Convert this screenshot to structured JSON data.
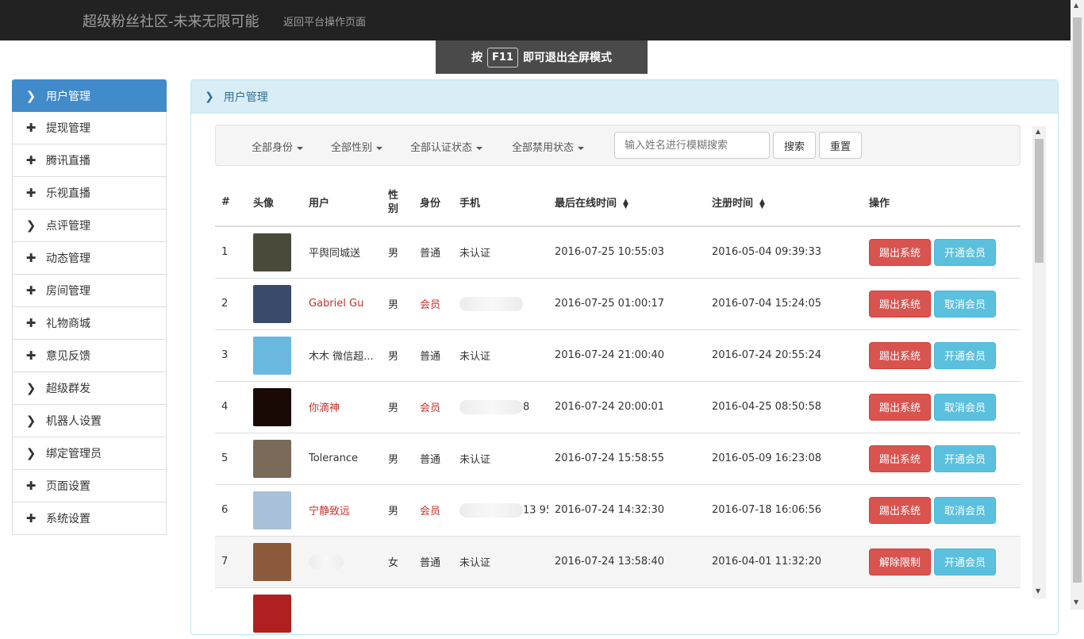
{
  "header": {
    "brand": "超级粉丝社区-未来无限可能",
    "back_link": "返回平台操作页面"
  },
  "fullscreen_notice": {
    "prefix": "按",
    "key": "F11",
    "suffix": "即可退出全屏模式"
  },
  "sidebar": {
    "items": [
      {
        "label": "用户管理",
        "icon": "chevron-right-icon",
        "active": true
      },
      {
        "label": "提现管理",
        "icon": "plus-icon"
      },
      {
        "label": "腾讯直播",
        "icon": "plus-icon"
      },
      {
        "label": "乐视直播",
        "icon": "plus-icon"
      },
      {
        "label": "点评管理",
        "icon": "chevron-right-icon"
      },
      {
        "label": "动态管理",
        "icon": "plus-icon"
      },
      {
        "label": "房间管理",
        "icon": "plus-icon"
      },
      {
        "label": "礼物商城",
        "icon": "plus-icon"
      },
      {
        "label": "意见反馈",
        "icon": "plus-icon"
      },
      {
        "label": "超级群发",
        "icon": "chevron-right-icon"
      },
      {
        "label": "机器人设置",
        "icon": "chevron-right-icon"
      },
      {
        "label": "绑定管理员",
        "icon": "chevron-right-icon"
      },
      {
        "label": "页面设置",
        "icon": "plus-icon"
      },
      {
        "label": "系统设置",
        "icon": "plus-icon"
      }
    ]
  },
  "panel": {
    "title": "用户管理"
  },
  "filters": {
    "identity": "全部身份",
    "gender": "全部性别",
    "verify": "全部认证状态",
    "ban": "全部禁用状态",
    "search_placeholder": "输入姓名进行模糊搜索",
    "search_value": "",
    "search_button": "搜索",
    "reset_button": "重置"
  },
  "table": {
    "headers": {
      "index": "#",
      "avatar": "头像",
      "user": "用户",
      "gender": "性别",
      "role": "身份",
      "phone": "手机",
      "last_online": "最后在线时间",
      "registered": "注册时间",
      "actions": "操作"
    },
    "rows": [
      {
        "idx": "1",
        "name": "平舆同城送",
        "gender": "男",
        "role": "普通",
        "phone": "未认证",
        "last_online": "2016-07-25 10:55:03",
        "registered": "2016-05-04 09:39:33",
        "action1": "踢出系统",
        "action2": "开通会员",
        "vip": false,
        "avatar_color": "#4a4a3a"
      },
      {
        "idx": "2",
        "name": "Gabriel Gu",
        "gender": "男",
        "role": "会员",
        "phone": "",
        "last_online": "2016-07-25 01:00:17",
        "registered": "2016-07-04 15:24:05",
        "action1": "踢出系统",
        "action2": "取消会员",
        "vip": true,
        "avatar_color": "#3a4a6a"
      },
      {
        "idx": "3",
        "name": "木木 微信超...",
        "gender": "男",
        "role": "普通",
        "phone": "未认证",
        "last_online": "2016-07-24 21:00:40",
        "registered": "2016-07-24 20:55:24",
        "action1": "踢出系统",
        "action2": "开通会员",
        "vip": false,
        "avatar_color": "#6ab8e0"
      },
      {
        "idx": "4",
        "name": "你滴神",
        "gender": "男",
        "role": "会员",
        "phone": "8",
        "last_online": "2016-07-24 20:00:01",
        "registered": "2016-04-25 08:50:58",
        "action1": "踢出系统",
        "action2": "取消会员",
        "vip": true,
        "avatar_color": "#1a0a05"
      },
      {
        "idx": "5",
        "name": "Tolerance",
        "gender": "男",
        "role": "普通",
        "phone": "未认证",
        "last_online": "2016-07-24 15:58:55",
        "registered": "2016-05-09 16:23:08",
        "action1": "踢出系统",
        "action2": "开通会员",
        "vip": false,
        "avatar_color": "#7a6a5a"
      },
      {
        "idx": "6",
        "name": "宁静致远",
        "gender": "男",
        "role": "会员",
        "phone": "13 95",
        "last_online": "2016-07-24 14:32:30",
        "registered": "2016-07-18 16:06:56",
        "action1": "踢出系统",
        "action2": "取消会员",
        "vip": true,
        "avatar_color": "#a8c0d8"
      },
      {
        "idx": "7",
        "name": "",
        "gender": "女",
        "role": "普通",
        "phone": "未认证",
        "last_online": "2016-07-24 13:58:40",
        "registered": "2016-04-01 11:32:20",
        "action1": "解除限制",
        "action2": "开通会员",
        "vip": false,
        "avatar_color": "#8a5a3a",
        "highlight": true
      },
      {
        "idx": "",
        "name": "",
        "gender": "",
        "role": "",
        "phone": "",
        "last_online": "",
        "registered": "",
        "action1": "",
        "action2": "",
        "vip": false,
        "avatar_color": "#b02020"
      }
    ]
  }
}
